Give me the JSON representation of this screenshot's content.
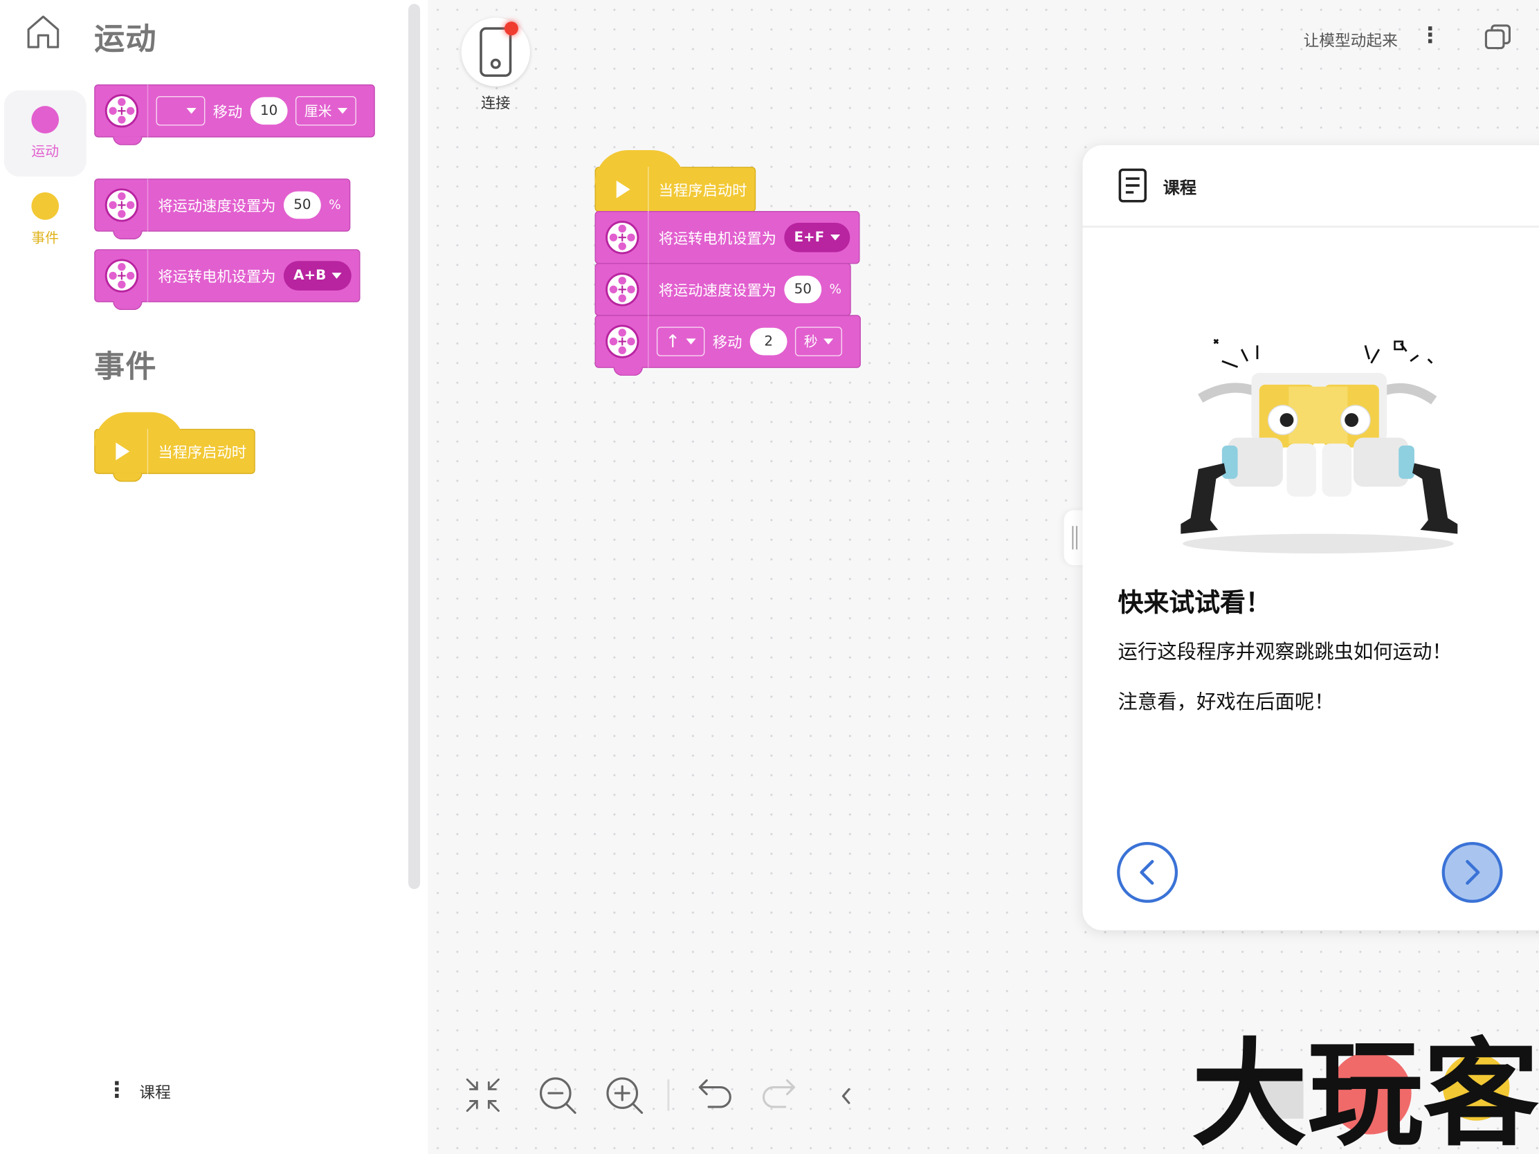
{
  "palette": {
    "categories": [
      {
        "label": "运动",
        "color": "#e25fcf",
        "active": true
      },
      {
        "label": "事件",
        "color": "#f2c834",
        "active": false
      }
    ],
    "motion_section_title": "运动",
    "events_section_title": "事件",
    "blocks": {
      "move": {
        "label": "移动",
        "distance": "10",
        "unit": "厘米",
        "direction": ""
      },
      "set_speed": {
        "label": "将运动速度设置为",
        "value": "50",
        "percent": "%"
      },
      "set_motors": {
        "label": "将运转电机设置为",
        "value": "A+B"
      },
      "when_start": {
        "label": "当程序启动时"
      }
    },
    "lesson_link": "课程"
  },
  "canvas": {
    "connect_label": "连接",
    "project_title": "让模型动起来",
    "program": {
      "when_start": "当程序启动时",
      "set_motors": {
        "label": "将运转电机设置为",
        "value": "E+F"
      },
      "set_speed": {
        "label": "将运动速度设置为",
        "value": "50",
        "percent": "%"
      },
      "move": {
        "direction": "↑",
        "label": "移动",
        "value": "2",
        "unit": "秒"
      }
    }
  },
  "lesson": {
    "title": "课程",
    "heading": "快来试试看！",
    "line1": "运行这段程序并观察跳跳虫如何运动！",
    "line2": "注意看，好戏在后面呢！"
  },
  "watermark": {
    "text": "大玩客"
  },
  "colors": {
    "motion": "#e25fcf",
    "event": "#f2c834",
    "accent_blue": "#3a72d6",
    "alert_red": "#f03b2f"
  },
  "icons": [
    "home-icon",
    "motor-icon",
    "play-icon",
    "phone-icon",
    "more-icon",
    "window-icon",
    "lesson-icon",
    "chevron-left-icon",
    "chevron-right-icon",
    "fit-screen-icon",
    "zoom-out-icon",
    "zoom-in-icon",
    "undo-icon",
    "redo-icon",
    "collapse-icon"
  ]
}
